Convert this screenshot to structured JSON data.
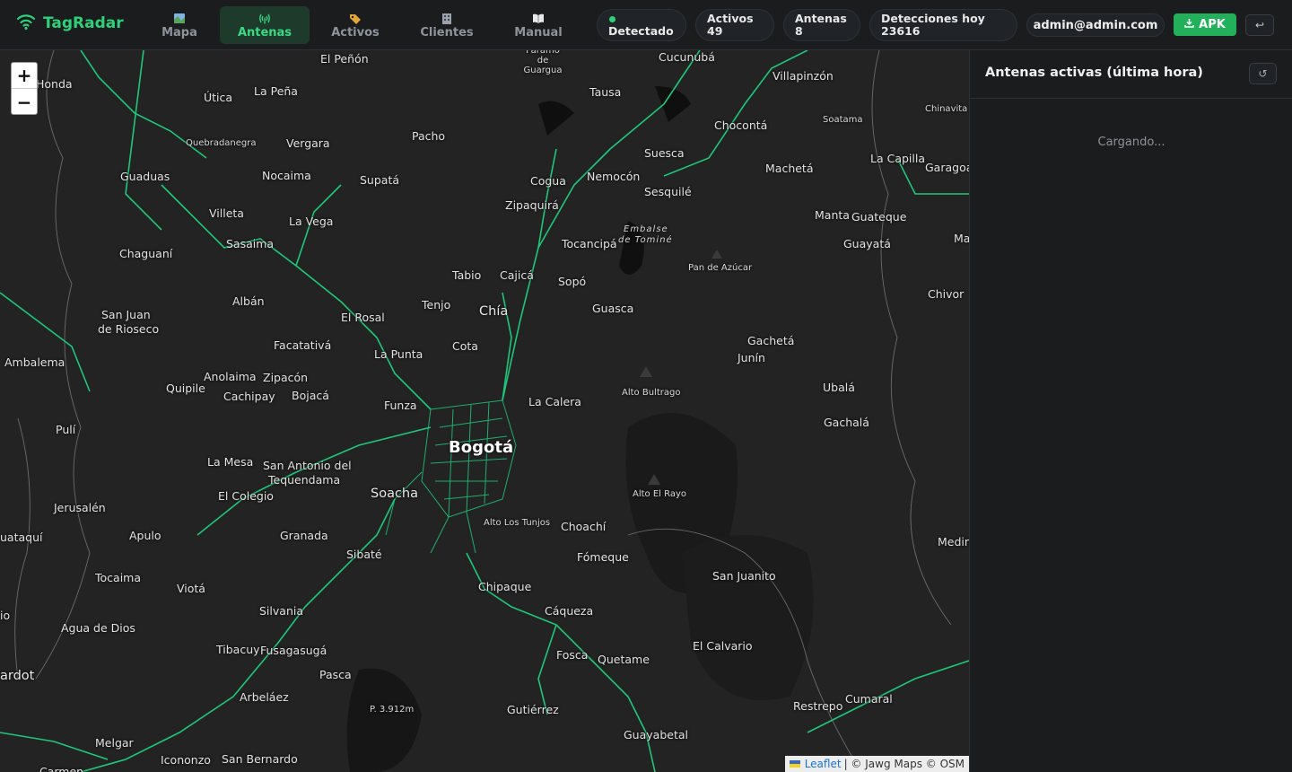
{
  "app": {
    "name": "TagRadar"
  },
  "nav": {
    "tabs": [
      {
        "label": "Mapa",
        "icon": "map-icon"
      },
      {
        "label": "Antenas",
        "icon": "antenna-icon",
        "active": true
      },
      {
        "label": "Activos",
        "icon": "tag-icon"
      },
      {
        "label": "Clientes",
        "icon": "building-icon"
      },
      {
        "label": "Manual",
        "icon": "book-icon"
      }
    ]
  },
  "status": {
    "detected_label": "Detectado",
    "activos_label": "Activos",
    "activos_value": "49",
    "antenas_label": "Antenas",
    "antenas_value": "8",
    "detecciones_label": "Detecciones hoy",
    "detecciones_value": "23616"
  },
  "user": {
    "email": "admin@admin.com"
  },
  "actions": {
    "apk_label": "APK",
    "logout_icon": "logout-icon"
  },
  "map": {
    "zoom_in": "+",
    "zoom_out": "−",
    "attribution": {
      "leaflet": "Leaflet",
      "rest": "| © Jawg Maps © OSM"
    },
    "places": [
      "Honda",
      "El Peñón",
      "Páramo de Guargua",
      "Cucunubá",
      "Villapinzón",
      "Útica",
      "La Peña",
      "Tausa",
      "Chinavita",
      "Soatama",
      "Chocontá",
      "Quebradanegra",
      "Vergara",
      "Pacho",
      "Suesca",
      "Machetá",
      "La Capilla",
      "Garagoa",
      "Guaduas",
      "Nocaima",
      "Supatá",
      "Cogua",
      "Nemocón",
      "Sesquilé",
      "Villeta",
      "Zipaquirá",
      "Manta",
      "Guateque",
      "La Vega",
      "Embalse",
      "de Tominé",
      "Sasaima",
      "Tocancipá",
      "Guayatá",
      "Chaguaní",
      "Pan de Azúcar",
      "Tabio",
      "Cajicá",
      "Sopó",
      "Chivor",
      "Albán",
      "Tenjo",
      "Chía",
      "San Juan",
      "de Rioseco",
      "El Rosal",
      "Guasca",
      "Facatativá",
      "Cota",
      "Gachetá",
      "La Punta",
      "Junín",
      "Ambalema",
      "Anolaima",
      "Zipacón",
      "Alto Bultrago",
      "Quipile",
      "Ubalá",
      "Cachipay",
      "Bojacá",
      "La Calera",
      "Funza",
      "Gachalá",
      "Pulí",
      "Bogotá",
      "La Mesa",
      "San Antonio del",
      "Tequendama",
      "Alto El Rayo",
      "El Colegio",
      "Soacha",
      "Jerusalén",
      "Alto Los Tunjos",
      "Choachí",
      "Apulo",
      "Granada",
      "uataquí",
      "Medin",
      "Sibaté",
      "Fómeque",
      "Tocaima",
      "San Juanito",
      "Viotá",
      "Chipaque",
      "Silvania",
      "Cáqueza",
      "Agua de Dios",
      "El Calvario",
      "Tibacuy",
      "Fusagasugá",
      "Fosca",
      "Quetame",
      "ardot",
      "Pasca",
      "Arbeláez",
      "Cumaral",
      "Restrepo",
      "P. 3.912m",
      "Gutiérrez",
      "Guayabetal",
      "Melgar",
      "Icononzo",
      "San Bernardo",
      "Carmen",
      "Ma",
      "io"
    ]
  },
  "panel": {
    "title": "Antenas activas (última hora)",
    "loading": "Cargando..."
  },
  "colors": {
    "accent": "#2fd07a",
    "road": "#1fc77b",
    "map_bg": "#232323"
  }
}
